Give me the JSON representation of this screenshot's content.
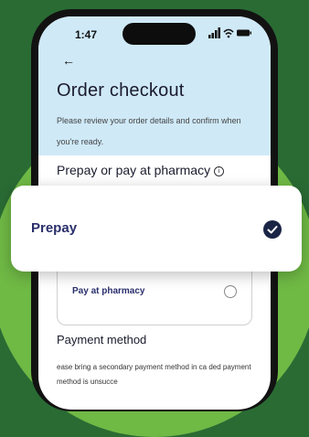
{
  "status_bar": {
    "time": "1:47"
  },
  "header": {
    "title": "Order checkout",
    "subtitle": "Please review your order details and confirm when you're ready."
  },
  "payment_timing": {
    "section_title": "Prepay or pay at pharmacy",
    "options": [
      {
        "label": "Prepay",
        "selected": true
      },
      {
        "label": "Pay at pharmacy",
        "selected": false
      }
    ]
  },
  "payment_method": {
    "title": "Payment method",
    "text": "ease bring a secondary payment method in ca ded payment method is unsucce"
  },
  "colors": {
    "background": "#2a6b34",
    "accent_circle": "#6fb945",
    "header": "#cfe9f7",
    "primary_text": "#2a2f6b",
    "check": "#1a2546"
  }
}
